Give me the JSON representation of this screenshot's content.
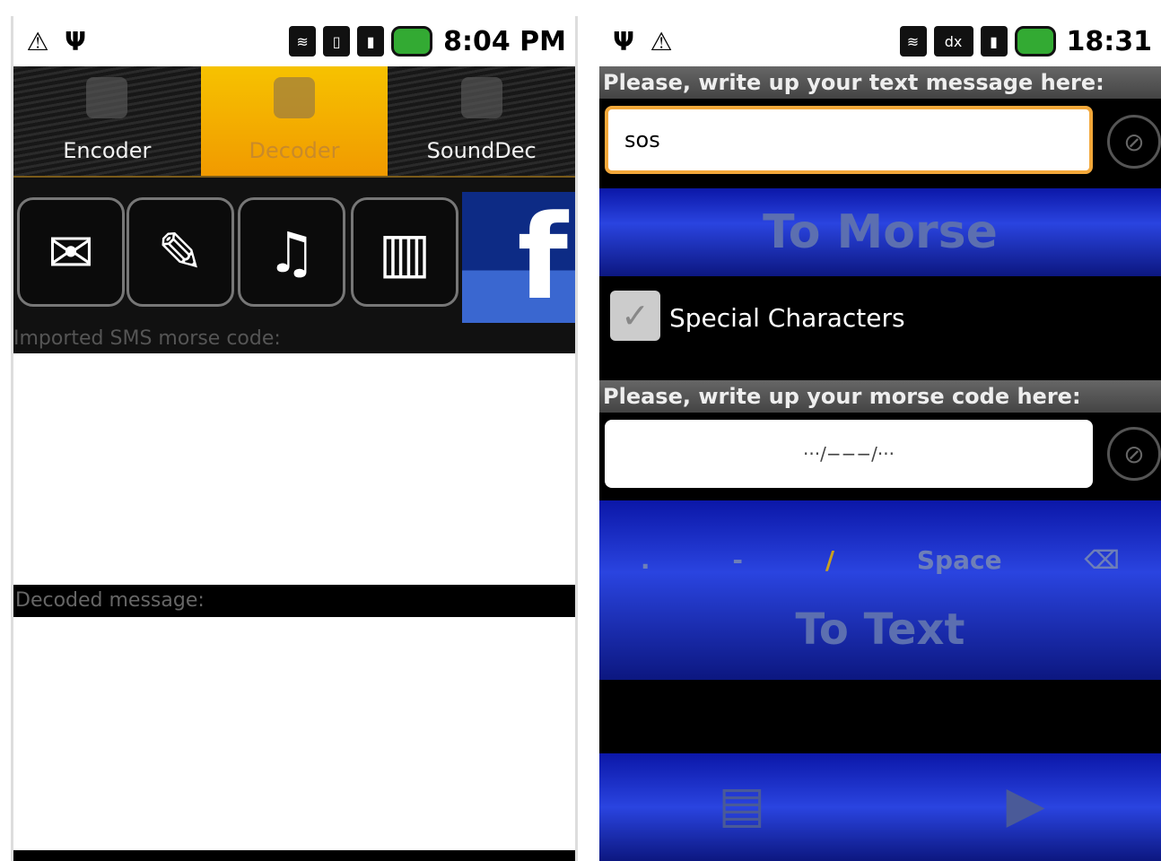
{
  "left": {
    "status": {
      "time": "8:04 PM",
      "icons": [
        "warning-icon",
        "usb-icon",
        "wifi-icon",
        "sim-icon",
        "signal-icon",
        "battery-icon"
      ]
    },
    "tabs": [
      {
        "label": "Encoder",
        "active": false
      },
      {
        "label": "Decoder",
        "active": true
      },
      {
        "label": "SoundDec",
        "active": false
      }
    ],
    "toolbar_icons": [
      "inbox-download-icon",
      "edit-document-icon",
      "music-note-icon",
      "phone-vibrate-icon",
      "facebook-icon"
    ],
    "input_hint": "Imported SMS morse code:",
    "decoded_label": "Decoded message:"
  },
  "right": {
    "status": {
      "time": "18:31",
      "icons": [
        "usb-icon",
        "warning-icon",
        "wifi-icon",
        "data-icon",
        "signal-icon",
        "battery-icon"
      ]
    },
    "text_label": "Please, write up your text message here:",
    "text_value": "sos",
    "to_morse_label": "To Morse",
    "special_characters_label": "Special Characters",
    "morse_label": "Please, write up your morse code here:",
    "morse_value": "···/−−−/···",
    "keys": [
      ".",
      "-",
      "/",
      "Space"
    ],
    "to_text_label": "To Text"
  }
}
